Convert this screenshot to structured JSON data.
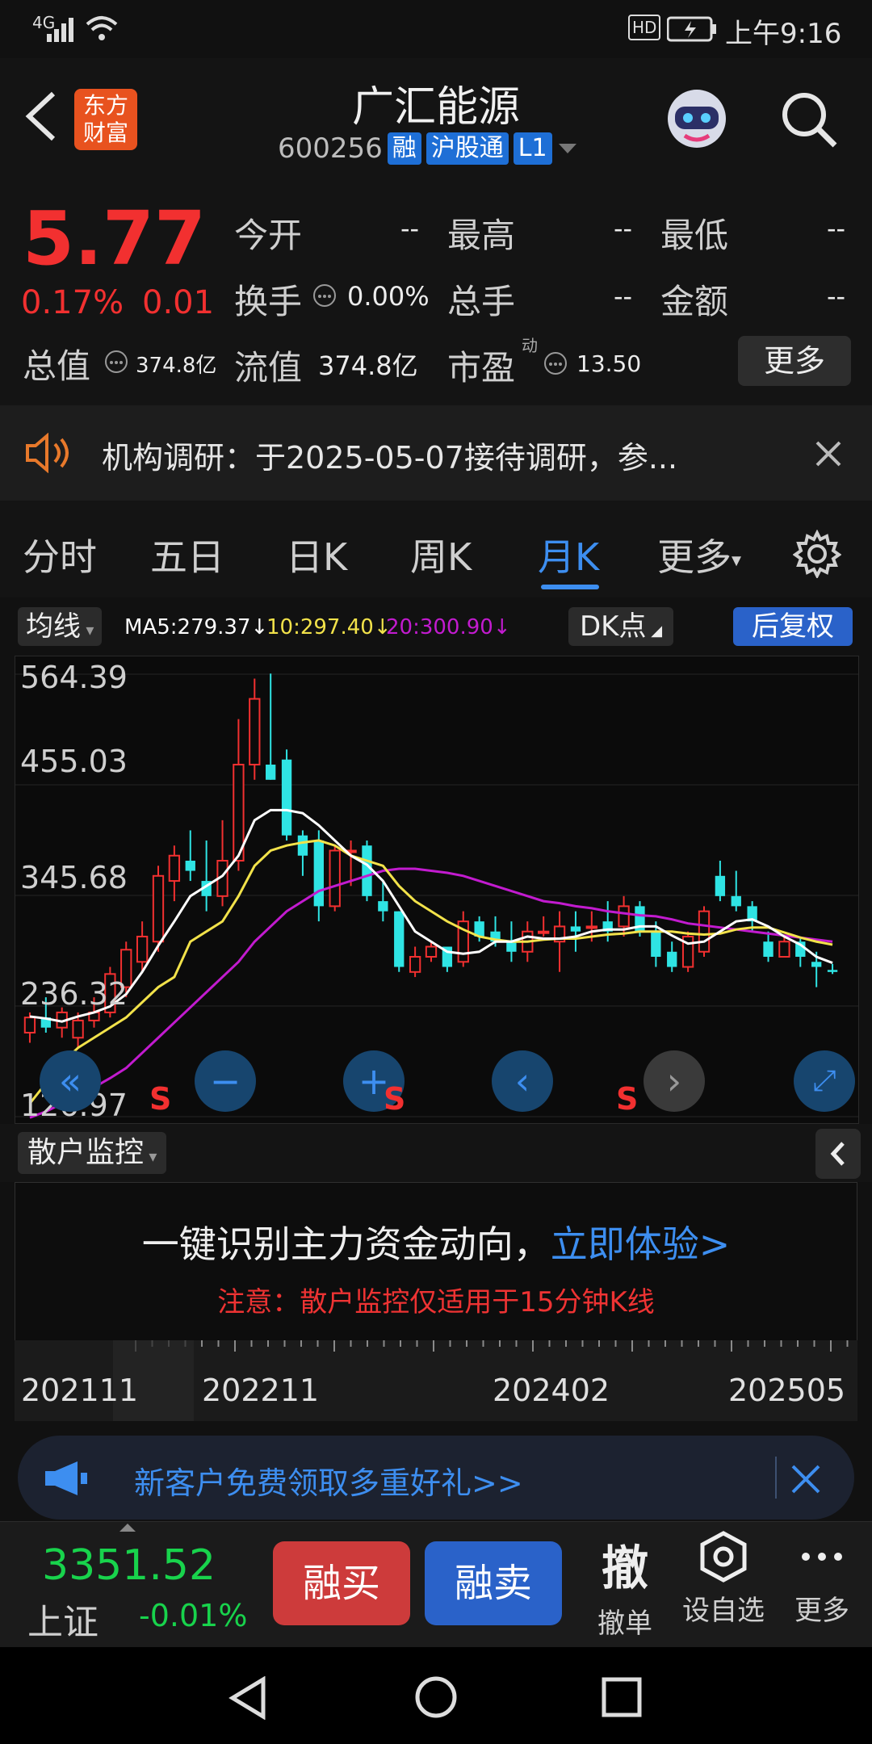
{
  "status_bar": {
    "network": "4G",
    "time": "上午9:16",
    "hd": "HD"
  },
  "header": {
    "logo_line1": "东方",
    "logo_line2": "财富",
    "title": "广汇能源",
    "code": "600256",
    "tags": [
      "融",
      "沪股通",
      "L1"
    ]
  },
  "quote": {
    "price": "5.77",
    "change_pct": "0.17%",
    "change_val": "0.01",
    "labels": {
      "open": "今开",
      "high": "最高",
      "low": "最低",
      "turnover": "换手",
      "volume": "总手",
      "amount": "金额",
      "mcap": "总值",
      "float_mcap": "流值",
      "pe": "市盈",
      "pe_sup": "动"
    },
    "values": {
      "open": "--",
      "high": "--",
      "low": "--",
      "turnover": "0.00%",
      "volume": "--",
      "amount": "--",
      "mcap": "374.8亿",
      "float_mcap": "374.8亿",
      "pe": "13.50"
    },
    "more_label": "更多"
  },
  "notice": {
    "text": "机构调研：于2025-05-07接待调研，参..."
  },
  "tabs": [
    {
      "label": "分时",
      "active": false
    },
    {
      "label": "五日",
      "active": false
    },
    {
      "label": "日K",
      "active": false
    },
    {
      "label": "周K",
      "active": false
    },
    {
      "label": "月K",
      "active": true
    },
    {
      "label": "更多",
      "active": false
    }
  ],
  "chart_header": {
    "ma_selector": "均线",
    "ma5": "MA5:279.37",
    "ma10": "10:297.40",
    "ma20": "20:300.90",
    "dk_label": "DK点",
    "fq_label": "后复权"
  },
  "colors": {
    "up": "#f23030",
    "down": "#2fe4e4",
    "ma5": "#ffffff",
    "ma10": "#f2e24a",
    "ma20": "#c21bcf",
    "accent": "#3d8ef0"
  },
  "chart_data": {
    "type": "candlestick",
    "y_ticks": [
      "564.39",
      "455.03",
      "345.68",
      "236.32",
      "126.97"
    ],
    "ylim": [
      126.97,
      564.39
    ],
    "x_ticks": [
      "202111",
      "202211",
      "202402",
      "202505"
    ],
    "signal_marks": [
      "S",
      "S",
      "S"
    ],
    "candles": [
      {
        "o": 210,
        "h": 230,
        "l": 200,
        "c": 225
      },
      {
        "o": 225,
        "h": 245,
        "l": 210,
        "c": 215
      },
      {
        "o": 215,
        "h": 235,
        "l": 205,
        "c": 230
      },
      {
        "o": 205,
        "h": 230,
        "l": 195,
        "c": 222
      },
      {
        "o": 222,
        "h": 245,
        "l": 215,
        "c": 230
      },
      {
        "o": 230,
        "h": 275,
        "l": 225,
        "c": 268
      },
      {
        "o": 255,
        "h": 300,
        "l": 245,
        "c": 292
      },
      {
        "o": 280,
        "h": 320,
        "l": 270,
        "c": 305
      },
      {
        "o": 300,
        "h": 375,
        "l": 290,
        "c": 365
      },
      {
        "o": 360,
        "h": 395,
        "l": 340,
        "c": 385
      },
      {
        "o": 380,
        "h": 410,
        "l": 360,
        "c": 370
      },
      {
        "o": 360,
        "h": 400,
        "l": 330,
        "c": 345
      },
      {
        "o": 345,
        "h": 420,
        "l": 335,
        "c": 380
      },
      {
        "o": 380,
        "h": 520,
        "l": 370,
        "c": 475
      },
      {
        "o": 475,
        "h": 560,
        "l": 460,
        "c": 540
      },
      {
        "o": 475,
        "h": 565,
        "l": 460,
        "c": 460
      },
      {
        "o": 480,
        "h": 490,
        "l": 400,
        "c": 405
      },
      {
        "o": 405,
        "h": 410,
        "l": 365,
        "c": 385
      },
      {
        "o": 400,
        "h": 410,
        "l": 320,
        "c": 335
      },
      {
        "o": 335,
        "h": 395,
        "l": 330,
        "c": 390
      },
      {
        "o": 390,
        "h": 400,
        "l": 355,
        "c": 390
      },
      {
        "o": 395,
        "h": 400,
        "l": 340,
        "c": 345
      },
      {
        "o": 340,
        "h": 360,
        "l": 320,
        "c": 330
      },
      {
        "o": 330,
        "h": 320,
        "l": 270,
        "c": 275
      },
      {
        "o": 270,
        "h": 295,
        "l": 265,
        "c": 285
      },
      {
        "o": 285,
        "h": 300,
        "l": 280,
        "c": 295
      },
      {
        "o": 295,
        "h": 295,
        "l": 270,
        "c": 275
      },
      {
        "o": 280,
        "h": 330,
        "l": 275,
        "c": 320
      },
      {
        "o": 320,
        "h": 325,
        "l": 300,
        "c": 305
      },
      {
        "o": 310,
        "h": 325,
        "l": 295,
        "c": 300
      },
      {
        "o": 300,
        "h": 320,
        "l": 280,
        "c": 290
      },
      {
        "o": 290,
        "h": 320,
        "l": 280,
        "c": 310
      },
      {
        "o": 310,
        "h": 325,
        "l": 305,
        "c": 310
      },
      {
        "o": 300,
        "h": 330,
        "l": 270,
        "c": 315
      },
      {
        "o": 315,
        "h": 330,
        "l": 290,
        "c": 310
      },
      {
        "o": 315,
        "h": 330,
        "l": 300,
        "c": 315
      },
      {
        "o": 320,
        "h": 340,
        "l": 300,
        "c": 310
      },
      {
        "o": 315,
        "h": 345,
        "l": 305,
        "c": 335
      },
      {
        "o": 335,
        "h": 340,
        "l": 305,
        "c": 310
      },
      {
        "o": 310,
        "h": 320,
        "l": 275,
        "c": 285
      },
      {
        "o": 290,
        "h": 300,
        "l": 270,
        "c": 275
      },
      {
        "o": 275,
        "h": 310,
        "l": 270,
        "c": 305
      },
      {
        "o": 290,
        "h": 335,
        "l": 285,
        "c": 330
      },
      {
        "o": 365,
        "h": 380,
        "l": 340,
        "c": 345
      },
      {
        "o": 345,
        "h": 370,
        "l": 330,
        "c": 335
      },
      {
        "o": 335,
        "h": 340,
        "l": 310,
        "c": 320
      },
      {
        "o": 300,
        "h": 310,
        "l": 280,
        "c": 285
      },
      {
        "o": 285,
        "h": 305,
        "l": 285,
        "c": 300
      },
      {
        "o": 300,
        "h": 305,
        "l": 275,
        "c": 285
      },
      {
        "o": 280,
        "h": 290,
        "l": 255,
        "c": 275
      },
      {
        "o": 272,
        "h": 278,
        "l": 268,
        "c": 270
      }
    ],
    "ma5": [
      226,
      224,
      221,
      226,
      230,
      236,
      248,
      270,
      296,
      320,
      345,
      355,
      365,
      385,
      420,
      430,
      430,
      427,
      415,
      400,
      385,
      376,
      360,
      335,
      310,
      300,
      290,
      288,
      290,
      300,
      300,
      305,
      303,
      303,
      305,
      310,
      312,
      312,
      315,
      315,
      306,
      298,
      300,
      310,
      320,
      322,
      315,
      305,
      297,
      285,
      279
    ],
    "ma10": [
      140,
      160,
      180,
      195,
      205,
      215,
      225,
      240,
      255,
      265,
      300,
      310,
      320,
      345,
      375,
      390,
      395,
      398,
      400,
      395,
      385,
      380,
      375,
      355,
      340,
      330,
      320,
      312,
      305,
      302,
      300,
      300,
      302,
      303,
      303,
      305,
      307,
      308,
      310,
      310,
      310,
      308,
      307,
      308,
      312,
      314,
      314,
      309,
      304,
      300,
      297
    ],
    "ma20": [
      126,
      132,
      140,
      148,
      156,
      165,
      175,
      190,
      205,
      220,
      235,
      250,
      265,
      280,
      300,
      315,
      330,
      340,
      350,
      355,
      360,
      365,
      370,
      372,
      372,
      370,
      368,
      365,
      360,
      355,
      350,
      345,
      340,
      338,
      335,
      333,
      330,
      328,
      326,
      325,
      322,
      318,
      316,
      314,
      312,
      310,
      308,
      306,
      304,
      302,
      300
    ]
  },
  "monitor": {
    "selector": "散户监控",
    "headline": "一键识别主力资金动向，",
    "cta": "立即体验>",
    "note": "注意：散户监控仅适用于15分钟K线"
  },
  "promo": {
    "text": "新客户免费领取多重好礼>>"
  },
  "tradebar": {
    "index_value": "3351.52",
    "index_name": "上证",
    "index_change": "-0.01%",
    "buy_label": "融买",
    "sell_label": "融卖",
    "cancel_glyph": "撤",
    "cancel_label": "撤单",
    "watch_label": "设自选",
    "more_label": "更多"
  }
}
